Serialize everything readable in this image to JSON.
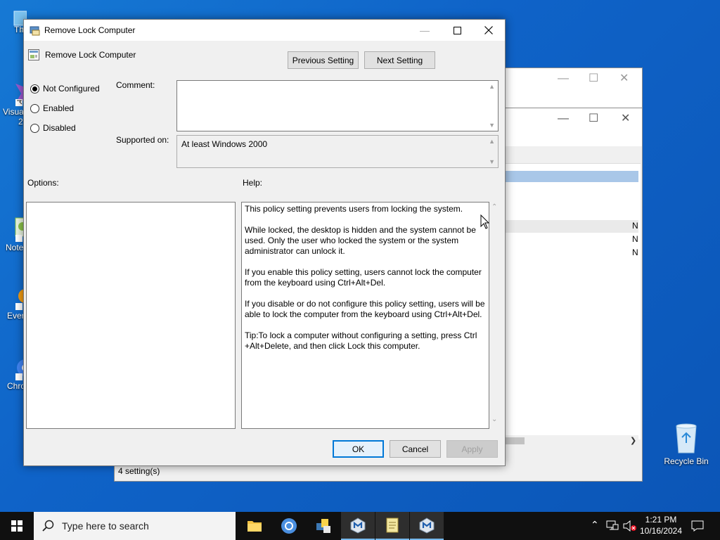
{
  "desktop": {
    "icons": [
      {
        "label": "Th"
      },
      {
        "label": "Visua"
      },
      {
        "label": "2"
      },
      {
        "label": "Note"
      },
      {
        "label": "Ever"
      },
      {
        "label": "Chro"
      }
    ],
    "recycle_bin": "Recycle Bin"
  },
  "background_window": {
    "status": "4 setting(s)",
    "col_values": [
      "N",
      "N",
      "N"
    ]
  },
  "dialog": {
    "title": "Remove Lock Computer",
    "header": "Remove Lock Computer",
    "prev_button": "Previous Setting",
    "next_button": "Next Setting",
    "radios": [
      {
        "label": "Not Configured",
        "selected": true
      },
      {
        "label": "Enabled",
        "selected": false
      },
      {
        "label": "Disabled",
        "selected": false
      }
    ],
    "comment_label": "Comment:",
    "comment_value": "",
    "supported_label": "Supported on:",
    "supported_value": "At least Windows 2000",
    "options_label": "Options:",
    "help_label": "Help:",
    "help_paragraphs": [
      "This policy setting prevents users from locking the system.",
      "While locked, the desktop is hidden and the system cannot be used. Only the user who locked the system or the system administrator can unlock it.",
      "If you enable this policy setting, users cannot lock the computer from the keyboard using Ctrl+Alt+Del.",
      "If you disable or do not configure this policy setting, users will be able to lock the computer from the keyboard using Ctrl+Alt+Del.",
      "Tip:To lock a computer without configuring a setting, press Ctrl +Alt+Delete, and then click Lock this computer."
    ],
    "ok": "OK",
    "cancel": "Cancel",
    "apply": "Apply"
  },
  "taskbar": {
    "search_placeholder": "Type here to search",
    "time": "1:21 PM",
    "date": "10/16/2024"
  },
  "colors": {
    "accent": "#0078d7",
    "taskbar": "#101010",
    "desktop": "#0f63c8"
  }
}
